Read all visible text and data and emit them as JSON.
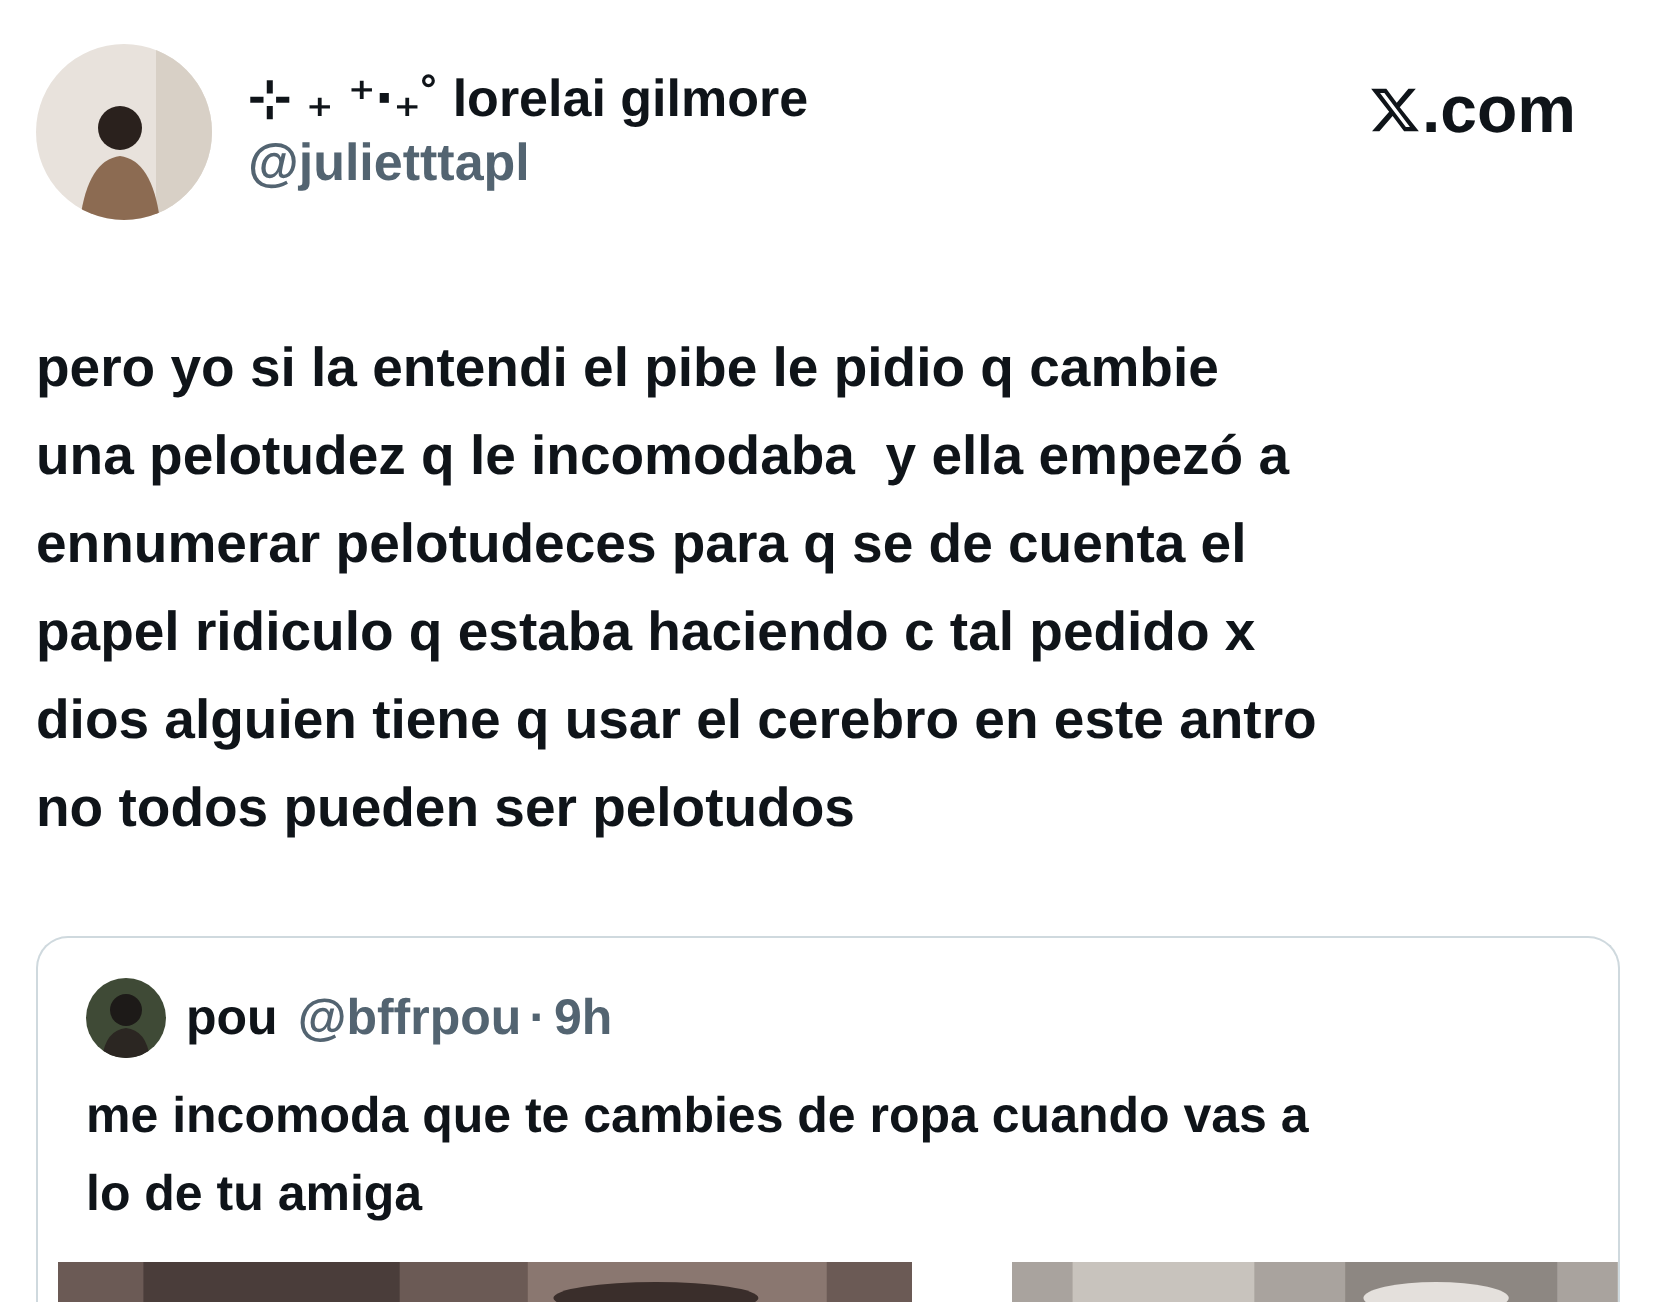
{
  "author": {
    "name": "⊹ ₊ ⁺‧₊˚ lorelai gilmore",
    "handle": "@julietttapl"
  },
  "site": {
    "suffix": ".com"
  },
  "text": "pero yo si la entendi el pibe le pidio q cambie\nuna pelotudez q le incomodaba  y ella empezó a\nennumerar pelotudeces para q se de cuenta el\npapel ridiculo q estaba haciendo c tal pedido x\ndios alguien tiene q usar el cerebro en este antro\nno todos pueden ser pelotudos",
  "quoted": {
    "name": "pou",
    "handle": "@bffrpou",
    "separator": "·",
    "time": "9h",
    "text": "me incomoda que te cambies de ropa cuando vas a\nlo de tu amiga"
  }
}
